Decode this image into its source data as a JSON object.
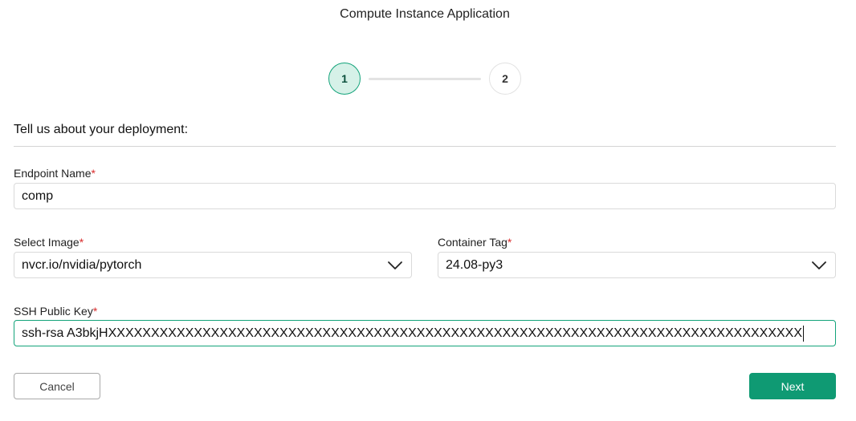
{
  "page": {
    "title": "Compute Instance Application"
  },
  "stepper": {
    "steps": [
      {
        "label": "1",
        "active": true
      },
      {
        "label": "2",
        "active": false
      }
    ],
    "active_color": "#13a37a"
  },
  "form": {
    "heading": "Tell us about your deployment:",
    "required_mark": "*",
    "endpoint_name": {
      "label": "Endpoint Name",
      "value": "comp"
    },
    "select_image": {
      "label": "Select Image",
      "value": "nvcr.io/nvidia/pytorch"
    },
    "container_tag": {
      "label": "Container Tag",
      "value": "24.08-py3"
    },
    "ssh_public_key": {
      "label": "SSH Public Key",
      "value": "ssh-rsa A3bkjHXXXXXXXXXXXXXXXXXXXXXXXXXXXXXXXXXXXXXXXXXXXXXXXXXXXXXXXXXXXXXXXXXXXXXXXXXXXXXXXXX"
    }
  },
  "actions": {
    "cancel_label": "Cancel",
    "next_label": "Next"
  },
  "colors": {
    "primary": "#0f9a73",
    "required": "#d92c2c"
  }
}
